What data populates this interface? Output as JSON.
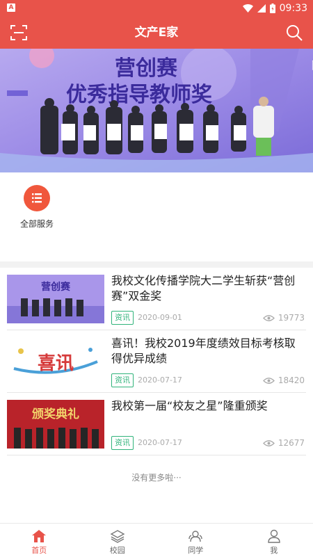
{
  "status_bar": {
    "time": "09:33",
    "app_icon_letter": "A"
  },
  "header": {
    "title": "文产E家",
    "left_icon": "scan-icon",
    "right_icon": "search-icon"
  },
  "banner": {
    "headline1": "营创赛",
    "headline2": "优秀指导教师奖",
    "right_glyph": "『"
  },
  "services": {
    "items": [
      {
        "label": "全部服务",
        "icon": "list-icon",
        "color": "#f0573c"
      }
    ]
  },
  "news": [
    {
      "title": "我校文化传播学院大二学生斩获“营创赛”双金奖",
      "tag": "资讯",
      "date": "2020-09-01",
      "views": "19773",
      "thumb_text": "营创赛"
    },
    {
      "title": "喜讯！我校2019年度绩效目标考核取得优异成绩",
      "tag": "资讯",
      "date": "2020-07-17",
      "views": "18420",
      "thumb_text": "喜讯"
    },
    {
      "title": "我校第一届“校友之星”隆重颁奖",
      "tag": "资讯",
      "date": "2020-07-17",
      "views": "12677",
      "thumb_text": "颁奖典礼"
    }
  ],
  "footer_note": "没有更多啦···",
  "bottom_nav": [
    {
      "label": "首页",
      "icon": "home-icon",
      "active": true
    },
    {
      "label": "校园",
      "icon": "layers-icon",
      "active": false
    },
    {
      "label": "同学",
      "icon": "classmates-icon",
      "active": false
    },
    {
      "label": "我",
      "icon": "person-icon",
      "active": false
    }
  ],
  "colors": {
    "primary": "#e8534a",
    "tag_green": "#2fb37a",
    "service_orange": "#f0573c"
  }
}
